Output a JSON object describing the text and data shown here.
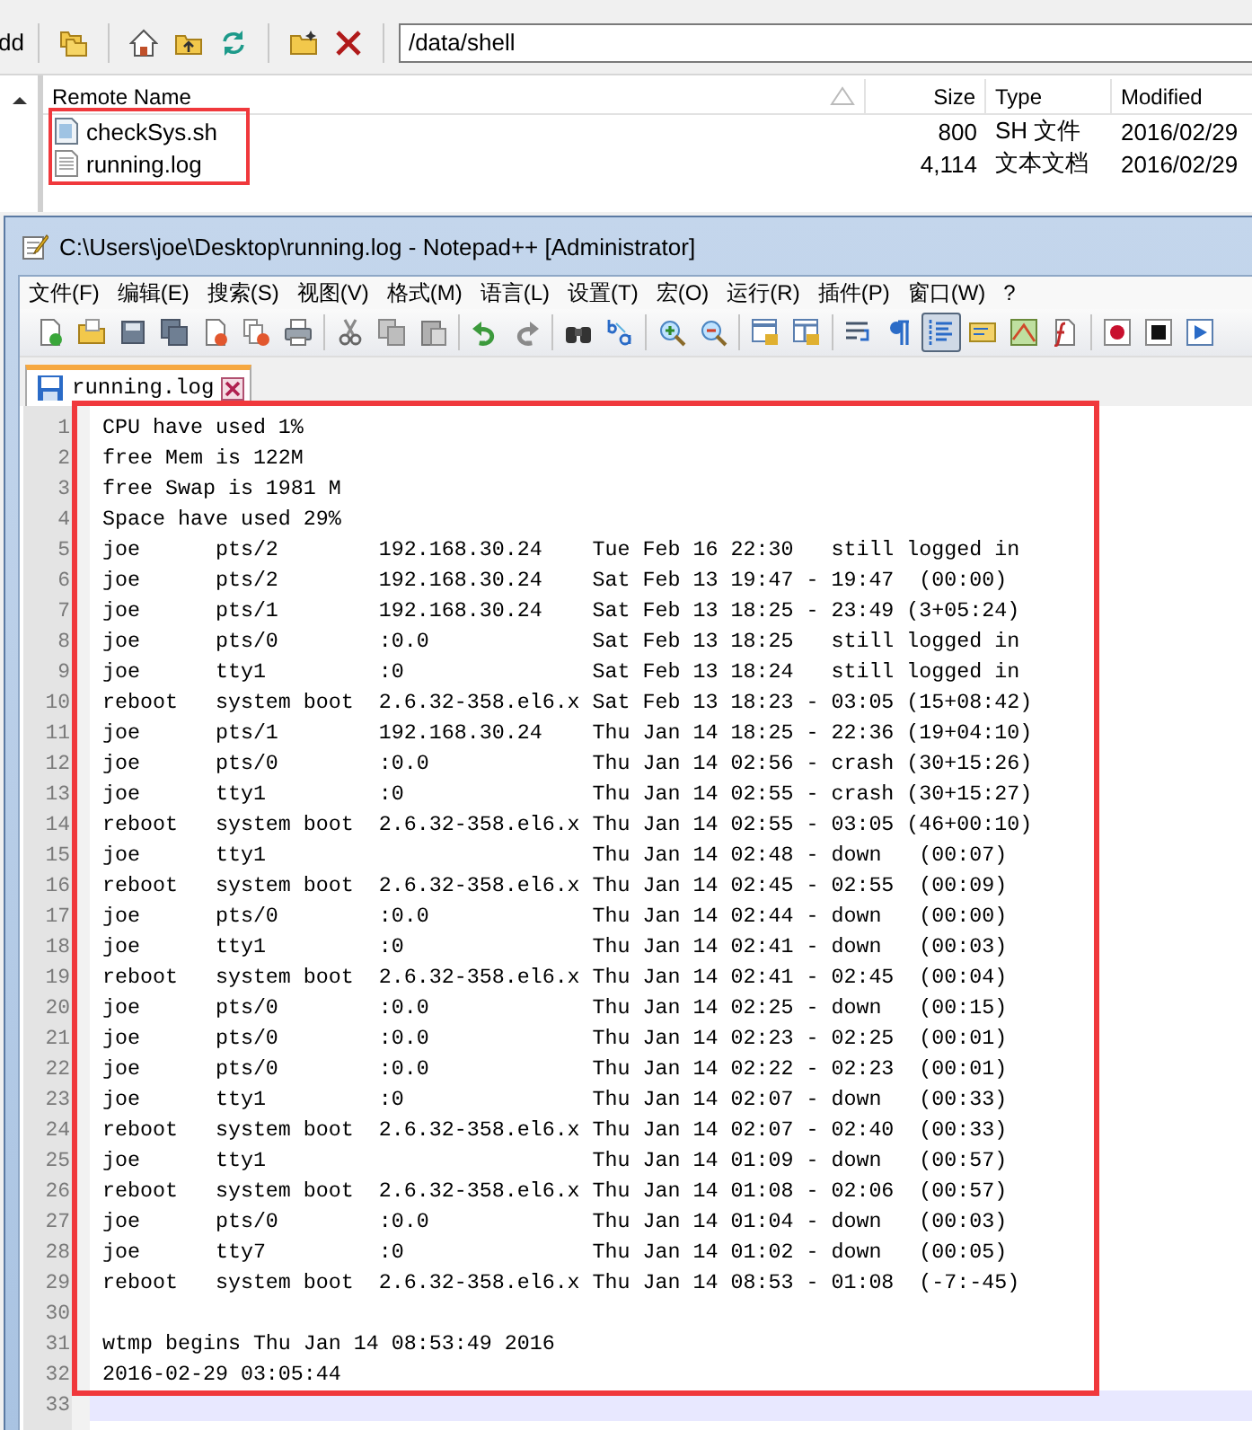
{
  "ftp": {
    "toolbar_label": "dd",
    "path": "/data/shell",
    "columns": [
      {
        "label": "Remote Name",
        "sorted": true
      },
      {
        "label": "Size",
        "sorted": false
      },
      {
        "label": "Type",
        "sorted": false
      },
      {
        "label": "Modified",
        "sorted": false
      }
    ],
    "files": [
      {
        "name": "checkSys.sh",
        "size": "800",
        "type": "SH 文件",
        "modified": "2016/02/29",
        "kind": "script"
      },
      {
        "name": "running.log",
        "size": "4,114",
        "type": "文本文档",
        "modified": "2016/02/29",
        "kind": "text"
      }
    ]
  },
  "notepad": {
    "title": "C:\\Users\\joe\\Desktop\\running.log - Notepad++ [Administrator]",
    "menu": [
      "文件(F)",
      "编辑(E)",
      "搜索(S)",
      "视图(V)",
      "格式(M)",
      "语言(L)",
      "设置(T)",
      "宏(O)",
      "运行(R)",
      "插件(P)",
      "窗口(W)",
      "?"
    ],
    "toolbar": [
      {
        "kind": "new",
        "pressed": false
      },
      {
        "kind": "open",
        "pressed": false
      },
      {
        "kind": "save",
        "pressed": false
      },
      {
        "kind": "save-all",
        "pressed": false
      },
      {
        "kind": "close",
        "pressed": false
      },
      {
        "kind": "close-all",
        "pressed": false
      },
      {
        "kind": "print",
        "pressed": false
      },
      {
        "kind": "sep"
      },
      {
        "kind": "cut",
        "pressed": false
      },
      {
        "kind": "copy",
        "pressed": false
      },
      {
        "kind": "paste",
        "pressed": false
      },
      {
        "kind": "sep"
      },
      {
        "kind": "undo",
        "pressed": false
      },
      {
        "kind": "redo",
        "pressed": false
      },
      {
        "kind": "sep"
      },
      {
        "kind": "find",
        "pressed": false
      },
      {
        "kind": "replace",
        "pressed": false
      },
      {
        "kind": "sep"
      },
      {
        "kind": "zoom-in",
        "pressed": false
      },
      {
        "kind": "zoom-out",
        "pressed": false
      },
      {
        "kind": "sep"
      },
      {
        "kind": "sync-vertical",
        "pressed": false
      },
      {
        "kind": "sync-horizontal",
        "pressed": false
      },
      {
        "kind": "sep"
      },
      {
        "kind": "wrap",
        "pressed": false
      },
      {
        "kind": "all-chars",
        "pressed": false
      },
      {
        "kind": "indent-guide",
        "pressed": true
      },
      {
        "kind": "language",
        "pressed": false
      },
      {
        "kind": "doc-map",
        "pressed": false
      },
      {
        "kind": "function-list",
        "pressed": false
      },
      {
        "kind": "sep"
      },
      {
        "kind": "record",
        "pressed": false
      },
      {
        "kind": "stop",
        "pressed": false
      },
      {
        "kind": "play",
        "pressed": false
      }
    ],
    "tabs": [
      {
        "label": "running.log",
        "selected": true
      }
    ],
    "lines": [
      {
        "number": "1",
        "text": "CPU have used 1%",
        "current": false
      },
      {
        "number": "2",
        "text": "free Mem is 122M",
        "current": false
      },
      {
        "number": "3",
        "text": "free Swap is 1981 M",
        "current": false
      },
      {
        "number": "4",
        "text": "Space have used 29%",
        "current": false
      },
      {
        "number": "5",
        "text": "joe      pts/2        192.168.30.24    Tue Feb 16 22:30   still logged in",
        "current": false
      },
      {
        "number": "6",
        "text": "joe      pts/2        192.168.30.24    Sat Feb 13 19:47 - 19:47  (00:00)",
        "current": false
      },
      {
        "number": "7",
        "text": "joe      pts/1        192.168.30.24    Sat Feb 13 18:25 - 23:49 (3+05:24)",
        "current": false
      },
      {
        "number": "8",
        "text": "joe      pts/0        :0.0             Sat Feb 13 18:25   still logged in",
        "current": false
      },
      {
        "number": "9",
        "text": "joe      tty1         :0               Sat Feb 13 18:24   still logged in",
        "current": false
      },
      {
        "number": "10",
        "text": "reboot   system boot  2.6.32-358.el6.x Sat Feb 13 18:23 - 03:05 (15+08:42)",
        "current": false
      },
      {
        "number": "11",
        "text": "joe      pts/1        192.168.30.24    Thu Jan 14 18:25 - 22:36 (19+04:10)",
        "current": false
      },
      {
        "number": "12",
        "text": "joe      pts/0        :0.0             Thu Jan 14 02:56 - crash (30+15:26)",
        "current": false
      },
      {
        "number": "13",
        "text": "joe      tty1         :0               Thu Jan 14 02:55 - crash (30+15:27)",
        "current": false
      },
      {
        "number": "14",
        "text": "reboot   system boot  2.6.32-358.el6.x Thu Jan 14 02:55 - 03:05 (46+00:10)",
        "current": false
      },
      {
        "number": "15",
        "text": "joe      tty1                          Thu Jan 14 02:48 - down   (00:07)",
        "current": false
      },
      {
        "number": "16",
        "text": "reboot   system boot  2.6.32-358.el6.x Thu Jan 14 02:45 - 02:55  (00:09)",
        "current": false
      },
      {
        "number": "17",
        "text": "joe      pts/0        :0.0             Thu Jan 14 02:44 - down   (00:00)",
        "current": false
      },
      {
        "number": "18",
        "text": "joe      tty1         :0               Thu Jan 14 02:41 - down   (00:03)",
        "current": false
      },
      {
        "number": "19",
        "text": "reboot   system boot  2.6.32-358.el6.x Thu Jan 14 02:41 - 02:45  (00:04)",
        "current": false
      },
      {
        "number": "20",
        "text": "joe      pts/0        :0.0             Thu Jan 14 02:25 - down   (00:15)",
        "current": false
      },
      {
        "number": "21",
        "text": "joe      pts/0        :0.0             Thu Jan 14 02:23 - 02:25  (00:01)",
        "current": false
      },
      {
        "number": "22",
        "text": "joe      pts/0        :0.0             Thu Jan 14 02:22 - 02:23  (00:01)",
        "current": false
      },
      {
        "number": "23",
        "text": "joe      tty1         :0               Thu Jan 14 02:07 - down   (00:33)",
        "current": false
      },
      {
        "number": "24",
        "text": "reboot   system boot  2.6.32-358.el6.x Thu Jan 14 02:07 - 02:40  (00:33)",
        "current": false
      },
      {
        "number": "25",
        "text": "joe      tty1                          Thu Jan 14 01:09 - down   (00:57)",
        "current": false
      },
      {
        "number": "26",
        "text": "reboot   system boot  2.6.32-358.el6.x Thu Jan 14 01:08 - 02:06  (00:57)",
        "current": false
      },
      {
        "number": "27",
        "text": "joe      pts/0        :0.0             Thu Jan 14 01:04 - down   (00:03)",
        "current": false
      },
      {
        "number": "28",
        "text": "joe      tty7         :0               Thu Jan 14 01:02 - down   (00:05)",
        "current": false
      },
      {
        "number": "29",
        "text": "reboot   system boot  2.6.32-358.el6.x Thu Jan 14 08:53 - 01:08  (-7:-45)",
        "current": false
      },
      {
        "number": "30",
        "current": false
      },
      {
        "number": "31",
        "text": "wtmp begins Thu Jan 14 08:53:49 2016",
        "current": false
      },
      {
        "number": "32",
        "text": "2016-02-29 03:05:44",
        "current": false
      },
      {
        "number": "33",
        "current": true
      }
    ]
  }
}
